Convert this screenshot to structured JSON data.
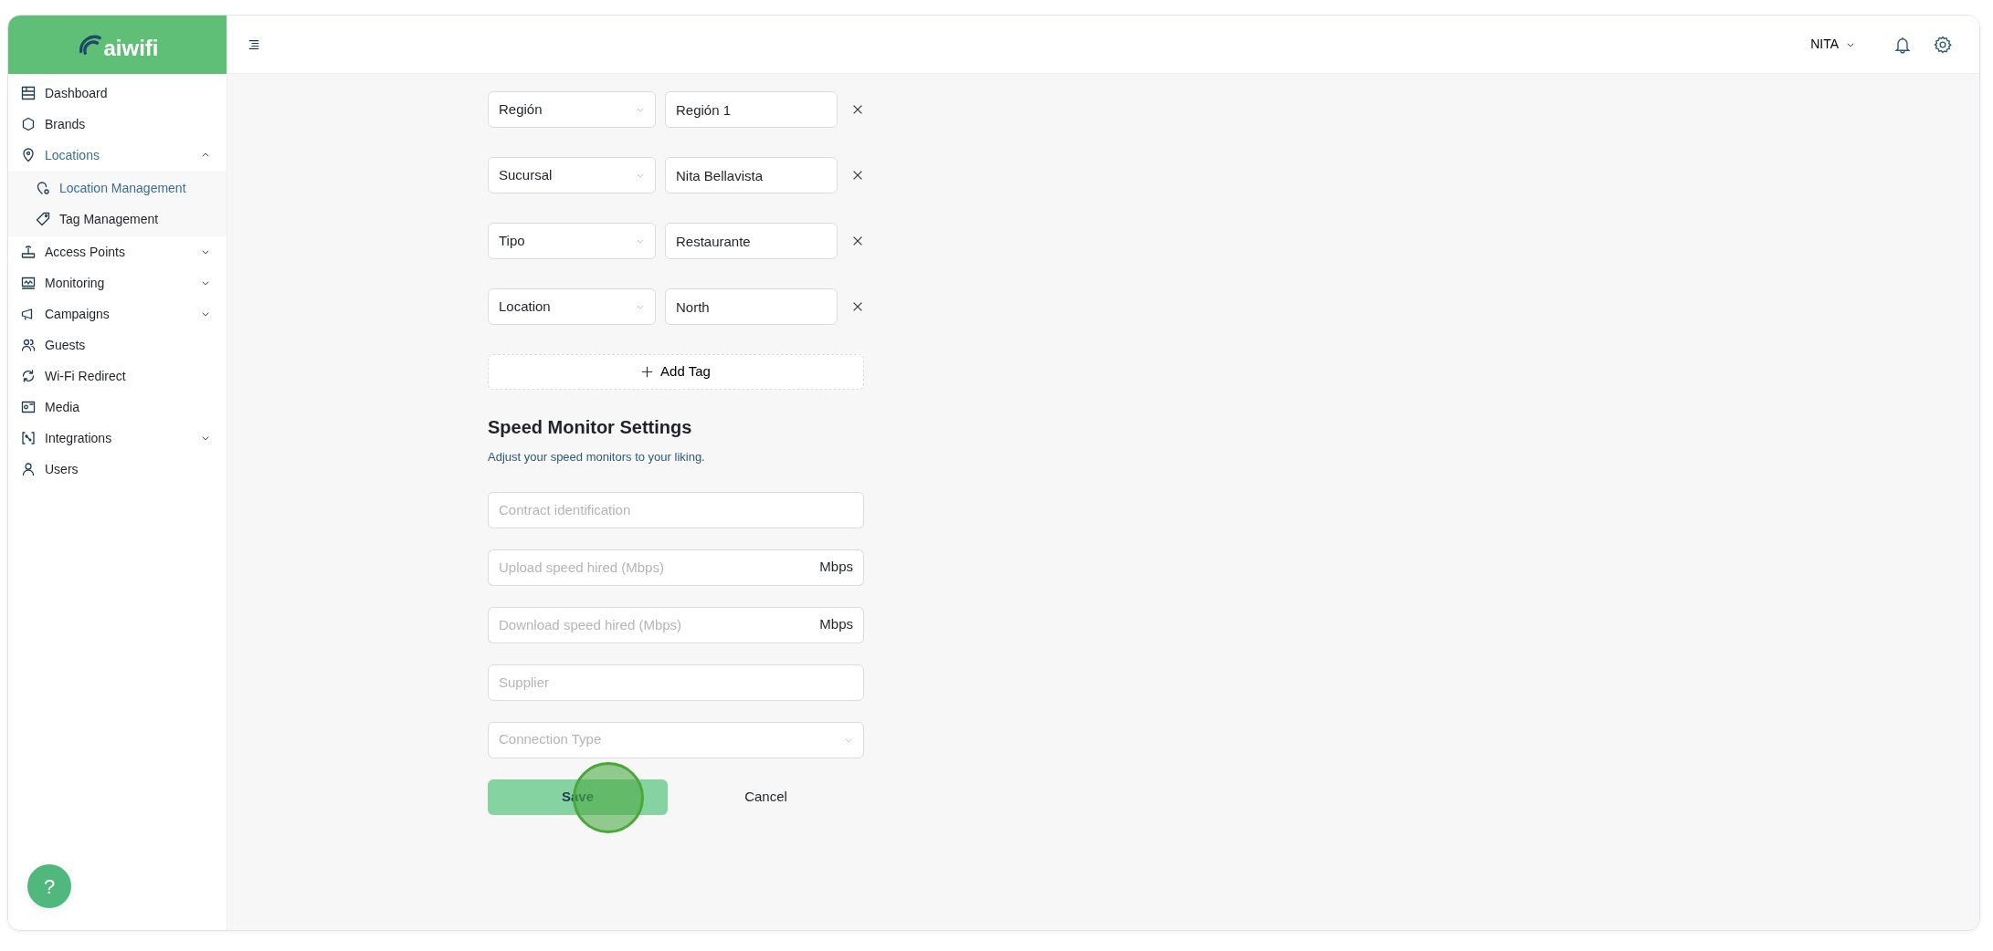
{
  "logo": {
    "text": "aiwifi"
  },
  "sidebar": {
    "items": [
      {
        "label": "Dashboard"
      },
      {
        "label": "Brands"
      },
      {
        "label": "Locations",
        "selected": true,
        "expanded": true,
        "children": [
          {
            "label": "Location Management",
            "selected": true
          },
          {
            "label": "Tag Management",
            "selected": false
          }
        ]
      },
      {
        "label": "Access Points",
        "selected": false,
        "expanded": false
      },
      {
        "label": "Monitoring",
        "selected": false,
        "expanded": false
      },
      {
        "label": "Campaigns",
        "selected": false,
        "expanded": false
      },
      {
        "label": "Guests"
      },
      {
        "label": "Wi-Fi Redirect"
      },
      {
        "label": "Media"
      },
      {
        "label": "Integrations",
        "selected": false,
        "expanded": false
      },
      {
        "label": "Users"
      }
    ]
  },
  "header": {
    "user": "NITA"
  },
  "location_tags": [
    {
      "key": "Región",
      "value": "Región 1"
    },
    {
      "key": "Sucursal",
      "value": "Nita Bellavista"
    },
    {
      "key": "Tipo",
      "value": "Restaurante"
    },
    {
      "key": "Location",
      "value": "North"
    }
  ],
  "add_tag_button": "Add Tag",
  "speed_monitor": {
    "title": "Speed Monitor Settings",
    "subtitle": "Adjust your speed monitors to your liking.",
    "fields": [
      {
        "kind": "text",
        "placeholder": "Contract identification"
      },
      {
        "kind": "unit",
        "placeholder": "Upload speed hired (Mbps)",
        "unit": "Mbps"
      },
      {
        "kind": "unit",
        "placeholder": "Download speed hired (Mbps)",
        "unit": "Mbps"
      },
      {
        "kind": "text",
        "placeholder": "Supplier"
      },
      {
        "kind": "select",
        "placeholder": "Connection Type"
      }
    ]
  },
  "actions": {
    "save": "Save",
    "cancel": "Cancel"
  },
  "help_button": "?"
}
